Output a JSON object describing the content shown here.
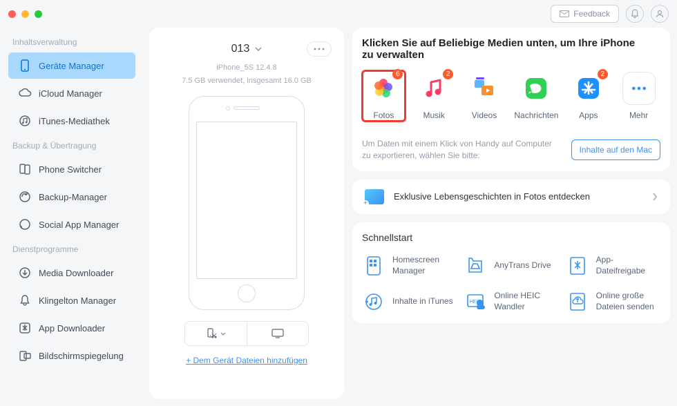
{
  "feedback_label": "Feedback",
  "sidebar": {
    "sections": [
      {
        "header": "Inhaltsverwaltung",
        "items": [
          {
            "label": "Geräte Manager",
            "name": "sidebar-device-manager",
            "active": true
          },
          {
            "label": "iCloud Manager",
            "name": "sidebar-icloud-manager"
          },
          {
            "label": "iTunes-Mediathek",
            "name": "sidebar-itunes-library"
          }
        ]
      },
      {
        "header": "Backup & Übertragung",
        "items": [
          {
            "label": "Phone Switcher",
            "name": "sidebar-phone-switcher"
          },
          {
            "label": "Backup-Manager",
            "name": "sidebar-backup-manager"
          },
          {
            "label": "Social App Manager",
            "name": "sidebar-social-app"
          }
        ]
      },
      {
        "header": "Dienstprogramme",
        "items": [
          {
            "label": "Media Downloader",
            "name": "sidebar-media-downloader"
          },
          {
            "label": "Klingelton Manager",
            "name": "sidebar-ringtone-manager"
          },
          {
            "label": "App Downloader",
            "name": "sidebar-app-downloader"
          },
          {
            "label": "Bildschirmspiegelung",
            "name": "sidebar-screen-mirror"
          }
        ]
      }
    ]
  },
  "device": {
    "name": "013",
    "model": "iPhone_5S 12.4.8",
    "storage": "7.5 GB verwendet, insgesamt 16.0 GB",
    "add_files": "+ Dem Gerät Dateien hinzufügen"
  },
  "media": {
    "title": "Klicken Sie auf Beliebige Medien unten, um Ihre iPhone zu verwalten",
    "items": [
      {
        "label": "Fotos",
        "badge": "6",
        "name": "media-photos",
        "highlighted": true
      },
      {
        "label": "Musik",
        "badge": "2",
        "name": "media-music"
      },
      {
        "label": "Videos",
        "name": "media-videos"
      },
      {
        "label": "Nachrichten",
        "name": "media-messages"
      },
      {
        "label": "Apps",
        "badge": "2",
        "name": "media-apps"
      },
      {
        "label": "Mehr",
        "name": "media-more"
      }
    ],
    "export_text": "Um Daten mit einem Klick von Handy auf Computer zu exportieren, wählen Sie bitte:",
    "export_button": "Inhalte auf den Mac"
  },
  "banner": {
    "text": "Exklusive Lebensgeschichten in Fotos entdecken"
  },
  "quickstart": {
    "title": "Schnellstart",
    "items": [
      {
        "label": "Homescreen Manager",
        "name": "qs-homescreen"
      },
      {
        "label": "AnyTrans Drive",
        "name": "qs-drive"
      },
      {
        "label": "App-Dateifreigabe",
        "name": "qs-fileshare"
      },
      {
        "label": "Inhalte in iTunes",
        "name": "qs-itunes"
      },
      {
        "label": "Online HEIC Wandler",
        "name": "qs-heic"
      },
      {
        "label": "Online große Dateien senden",
        "name": "qs-bigfiles"
      }
    ]
  }
}
